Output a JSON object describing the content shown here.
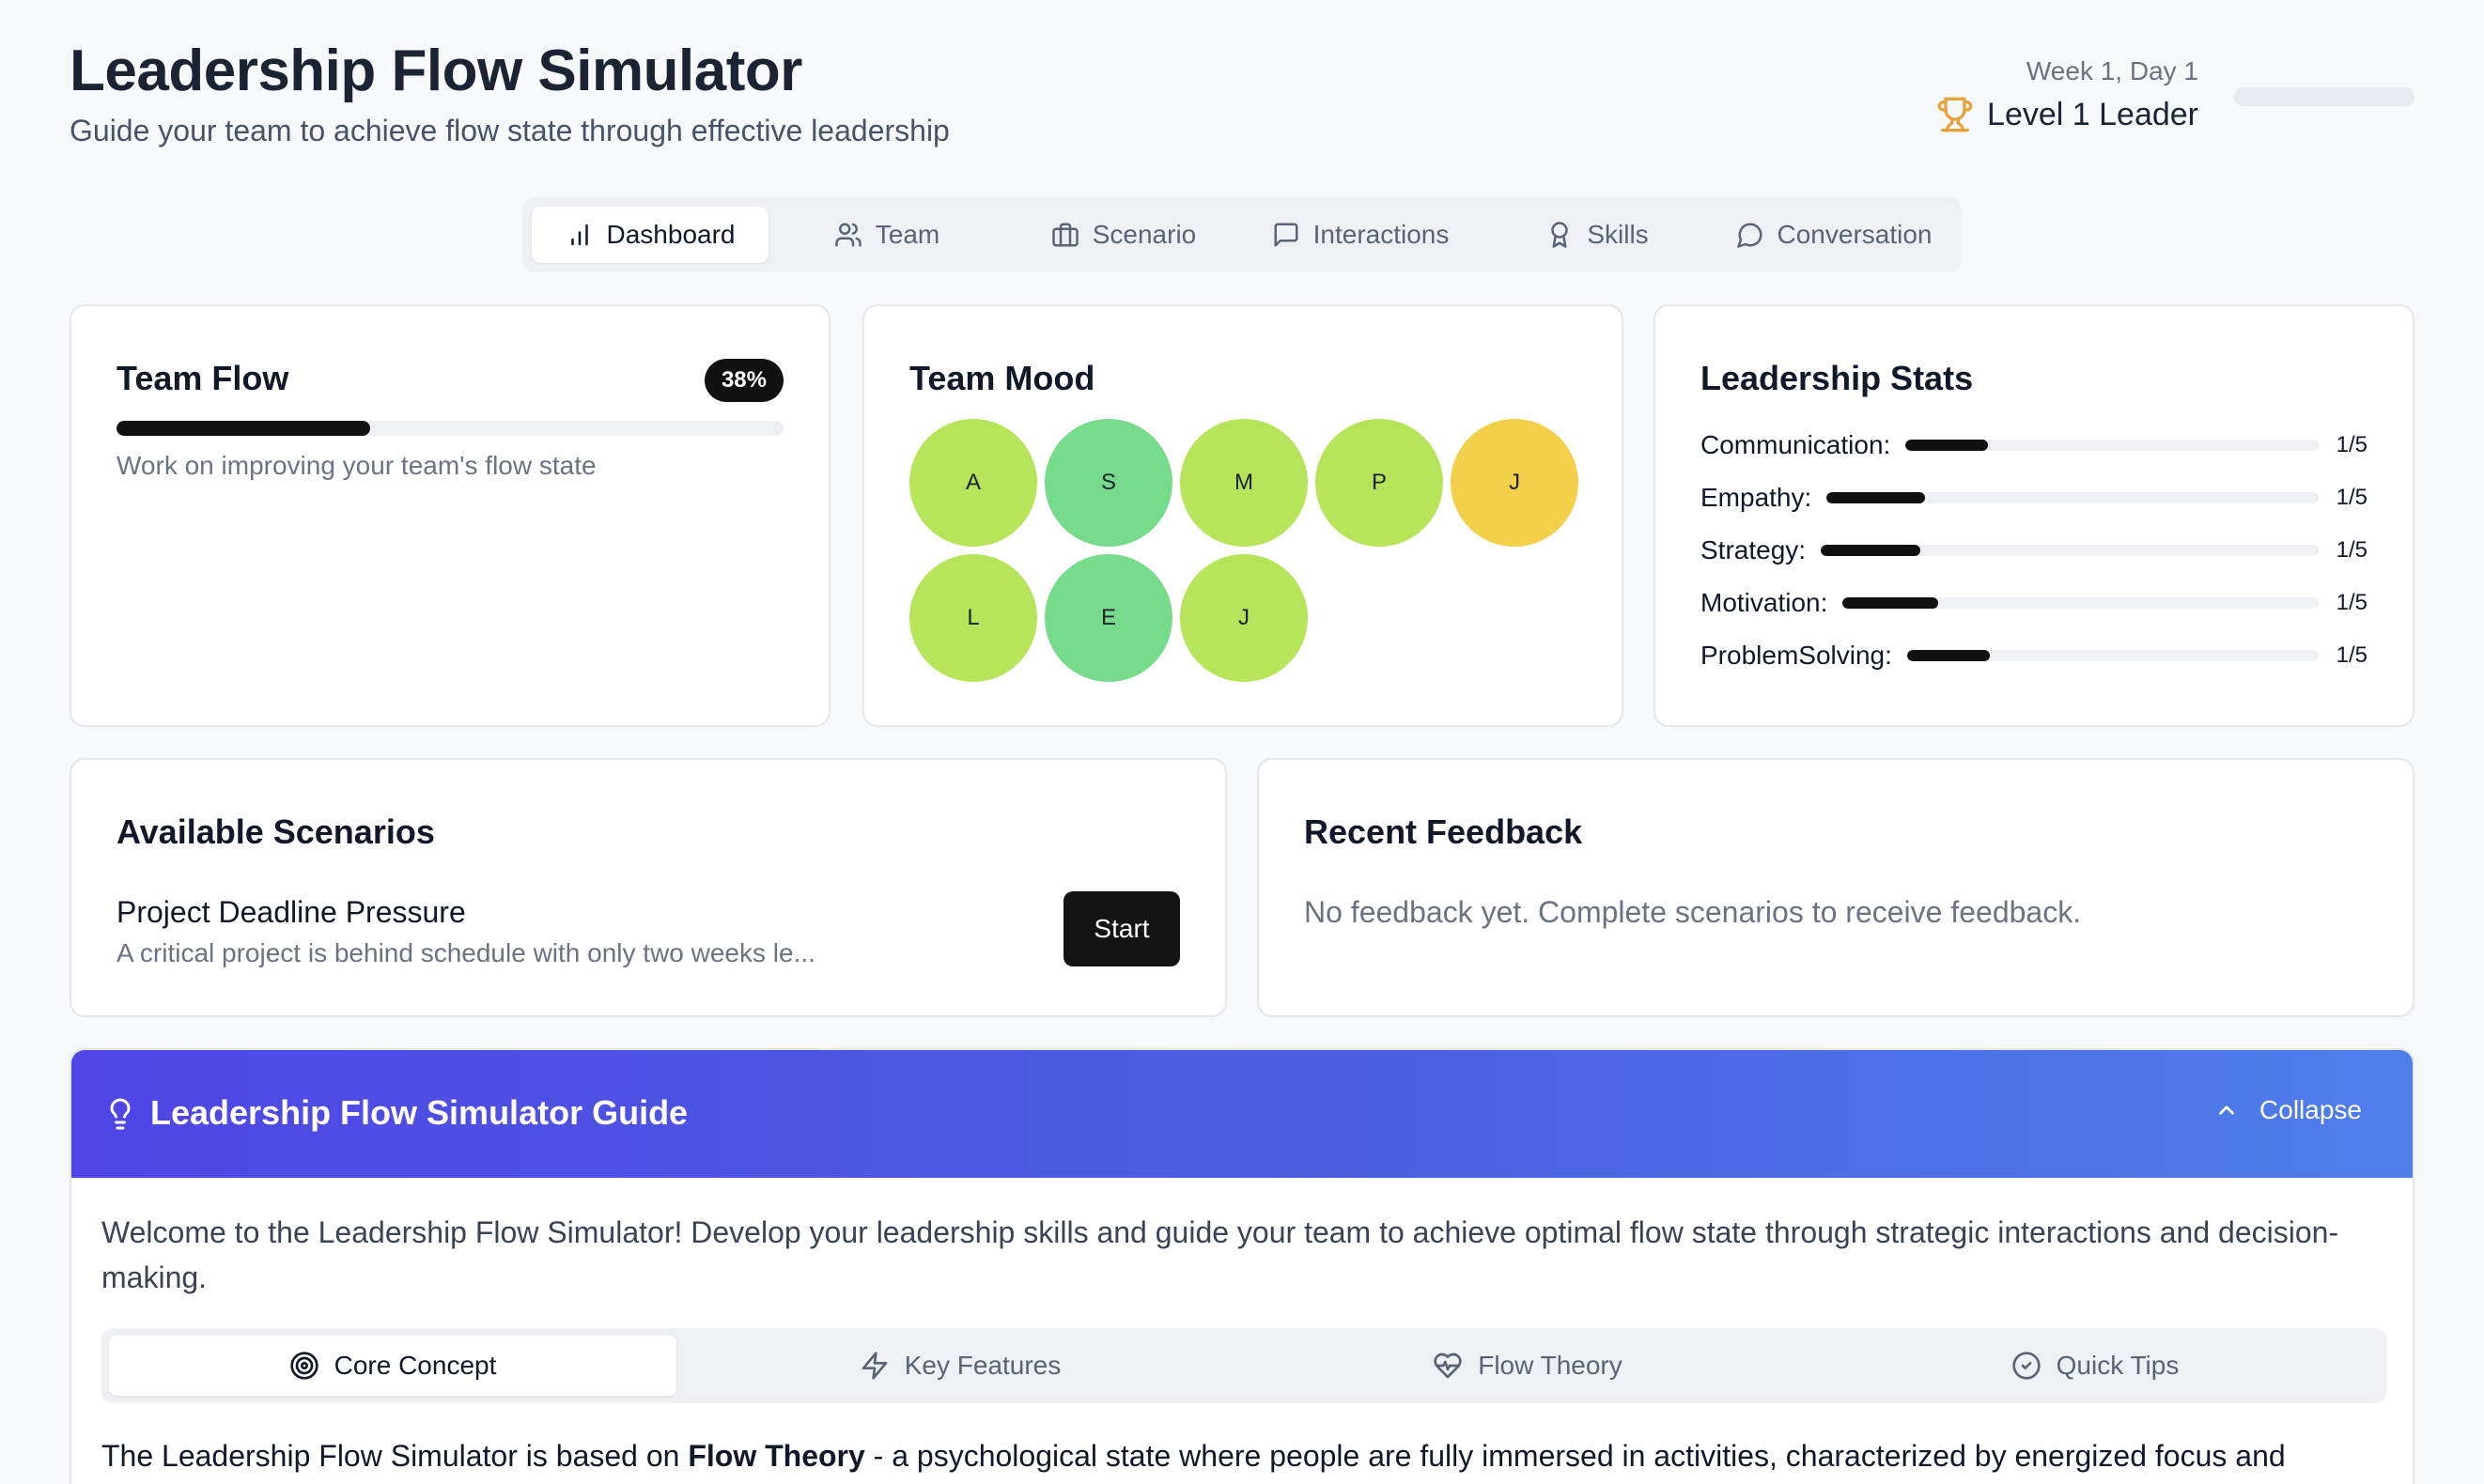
{
  "header": {
    "title": "Leadership Flow Simulator",
    "subtitle": "Guide your team to achieve flow state through effective leadership",
    "week_day": "Week 1, Day 1",
    "level": "Level 1 Leader"
  },
  "nav": {
    "tabs": [
      {
        "label": "Dashboard",
        "icon": "bar-chart-icon",
        "active": true
      },
      {
        "label": "Team",
        "icon": "users-icon"
      },
      {
        "label": "Scenario",
        "icon": "briefcase-icon"
      },
      {
        "label": "Interactions",
        "icon": "message-square-icon"
      },
      {
        "label": "Skills",
        "icon": "award-icon"
      },
      {
        "label": "Conversation",
        "icon": "message-circle-icon"
      }
    ]
  },
  "team_flow": {
    "title": "Team Flow",
    "badge": "38%",
    "value": 0.38,
    "message": "Work on improving your team's flow state"
  },
  "team_mood": {
    "title": "Team Mood",
    "members": [
      {
        "initial": "A",
        "color": "#b6e45a"
      },
      {
        "initial": "S",
        "color": "#77db8c"
      },
      {
        "initial": "M",
        "color": "#b6e45a"
      },
      {
        "initial": "P",
        "color": "#b6e45a"
      },
      {
        "initial": "J",
        "color": "#f3d04a"
      },
      {
        "initial": "L",
        "color": "#b6e45a"
      },
      {
        "initial": "E",
        "color": "#77db8c"
      },
      {
        "initial": "J",
        "color": "#b6e45a"
      }
    ]
  },
  "leadership_stats": {
    "title": "Leadership Stats",
    "stats": [
      {
        "label": "Communication:",
        "value": "1/5",
        "fraction": 0.2
      },
      {
        "label": "Empathy:",
        "value": "1/5",
        "fraction": 0.2
      },
      {
        "label": "Strategy:",
        "value": "1/5",
        "fraction": 0.2
      },
      {
        "label": "Motivation:",
        "value": "1/5",
        "fraction": 0.2
      },
      {
        "label": "ProblemSolving:",
        "value": "1/5",
        "fraction": 0.2
      }
    ]
  },
  "scenarios": {
    "title": "Available Scenarios",
    "item_name": "Project Deadline Pressure",
    "item_desc": "A critical project is behind schedule with only two weeks le...",
    "start_label": "Start"
  },
  "feedback": {
    "title": "Recent Feedback",
    "empty": "No feedback yet. Complete scenarios to receive feedback."
  },
  "guide": {
    "title": "Leadership Flow Simulator Guide",
    "collapse_label": "Collapse",
    "intro": "Welcome to the Leadership Flow Simulator! Develop your leadership skills and guide your team to achieve optimal flow state through strategic interactions and decision-making.",
    "tabs": [
      {
        "label": "Core Concept",
        "icon": "target-icon",
        "active": true
      },
      {
        "label": "Key Features",
        "icon": "zap-icon"
      },
      {
        "label": "Flow Theory",
        "icon": "heart-pulse-icon"
      },
      {
        "label": "Quick Tips",
        "icon": "check-circle-icon"
      }
    ],
    "body_start": "The Leadership Flow Simulator is based on ",
    "body_bold": "Flow Theory",
    "body_end": " - a psychological state where people are fully immersed in activities, characterized by energized focus and"
  },
  "colors": {
    "accent": "#111111",
    "guide_gradient_start": "#4f46e5",
    "guide_gradient_end": "#4f7eea",
    "trophy": "#e9a23b"
  }
}
